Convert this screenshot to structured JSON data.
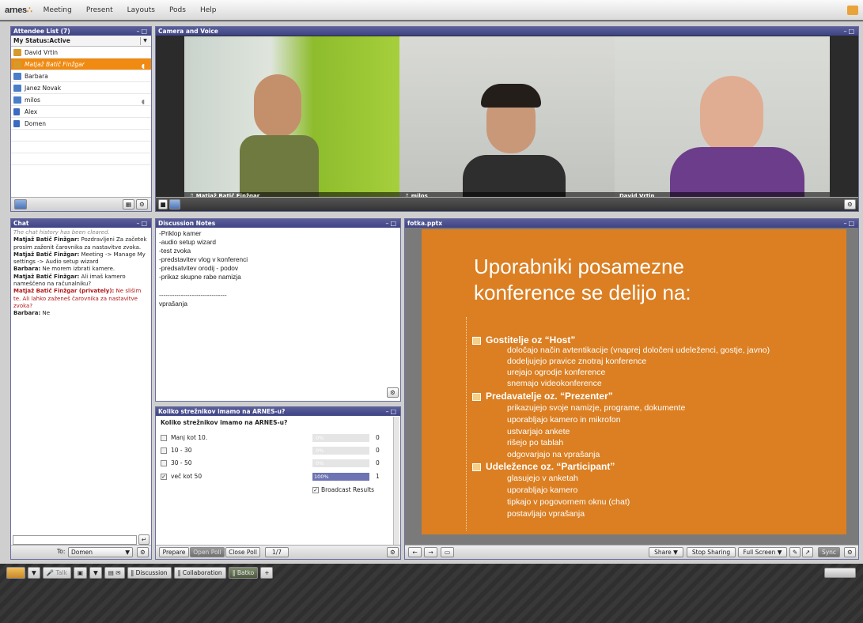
{
  "menubar": {
    "logo": "arnes",
    "items": [
      "Meeting",
      "Present",
      "Layouts",
      "Pods",
      "Help"
    ]
  },
  "attendees": {
    "title": "Attendee List (7)",
    "status": "My Status:Active",
    "rows": [
      {
        "name": "David Vrtin",
        "role": "host"
      },
      {
        "name": "Matjaž Batič Finžgar",
        "role": "host"
      },
      {
        "name": "Barbara",
        "role": "presenter"
      },
      {
        "name": "Janez Novak",
        "role": "presenter"
      },
      {
        "name": "milos",
        "role": "presenter"
      },
      {
        "name": "Alex",
        "role": "participant"
      },
      {
        "name": "Domen",
        "role": "participant"
      }
    ]
  },
  "camera": {
    "title": "Camera and Voice",
    "feeds": [
      "Matjaž Batič Finžgar",
      "milos",
      "David Vrtin"
    ]
  },
  "chat": {
    "title": "Chat",
    "history_note": "The chat history has been cleared.",
    "messages": [
      {
        "sender": "Matjaž Batič Finžgar:",
        "text": " Pozdravljeni Za začetek prosim zaženit čarovnika za nastavitve zvoka.",
        "private": false
      },
      {
        "sender": "Matjaž Batič Finžgar:",
        "text": " Meeting -> Manage My settings -> Audio setup wizard",
        "private": false
      },
      {
        "sender": "Barbara:",
        "text": " Ne morem izbrati kamere.",
        "private": false
      },
      {
        "sender": "Matjaž Batič Finžgar:",
        "text": " Ali imaš kamero nameščeno na računalniku?",
        "private": false
      },
      {
        "sender": "Matjaž Batič Finžgar (privately):",
        "text": " Ne slišim te. Ali lahko zaženeš čarovnika za nastavitve zvoka?",
        "private": true
      },
      {
        "sender": "Barbara:",
        "text": " Ne",
        "private": false
      }
    ],
    "to_label": "To:",
    "to_value": "Domen"
  },
  "notes": {
    "title": "Discussion Notes",
    "lines": [
      "-Priklop kamer",
      "-audio setup wizard",
      "-test zvoka",
      "-predstavitev vlog v konferenci",
      "-predsatvitev orodij - podov",
      "-prikaz skupne rabe namizja",
      "",
      "-------------------------------",
      "vprašanja"
    ]
  },
  "poll": {
    "title": "Koliko strežnikov imamo na ARNES-u?",
    "question": "Koliko strežnikov imamo na ARNES-u?",
    "options": [
      {
        "label": "Manj kot 10.",
        "pct": 0,
        "pct_label": "0%",
        "count": "0",
        "checked": false
      },
      {
        "label": "10 - 30",
        "pct": 0,
        "pct_label": "0%",
        "count": "0",
        "checked": false
      },
      {
        "label": "30 - 50",
        "pct": 0,
        "pct_label": "0%",
        "count": "0",
        "checked": false
      },
      {
        "label": "več kot 50",
        "pct": 100,
        "pct_label": "100%",
        "count": "1",
        "checked": true
      }
    ],
    "broadcast": "Broadcast Results",
    "buttons": [
      "Prepare",
      "Open Poll",
      "Close Poll",
      "1/7"
    ]
  },
  "slides": {
    "title": "fotka.pptx",
    "heading_line1": "Uporabniki posamezne",
    "heading_line2": "konference se delijo na:",
    "sections": [
      {
        "title": "Gostitelje oz “Host”",
        "items": [
          "določajo način avtentikacije (vnaprej določeni udeleženci, gostje, javno)",
          "dodeljujejo pravice znotraj konference",
          "urejajo ogrodje konference",
          "snemajo videokonference"
        ]
      },
      {
        "title": "Predavatelje oz. “Prezenter”",
        "items": [
          "prikazujejo svoje namizje, programe, dokumente",
          "uporabljajo kamero in mikrofon",
          "ustvarjajo ankete",
          "rišejo po tablah",
          "odgovarjajo na vprašanja"
        ]
      },
      {
        "title": "Udeležence oz. “Participant”",
        "items": [
          "glasujejo v anketah",
          "uporabljajo kamero",
          "tipkajo v pogovornem oknu (chat)",
          "postavljajo vprašanja"
        ]
      }
    ],
    "buttons": {
      "share": "Share",
      "stop": "Stop Sharing",
      "full": "Full Screen",
      "sync": "Sync"
    }
  },
  "taskbar": {
    "talk": "Talk",
    "tabs": [
      "Discussion",
      "Collaboration",
      "Batko"
    ],
    "add": "+"
  },
  "colors": {
    "accent": "#f08a10",
    "pod_title": "#474c8c",
    "slide_bg": "#db7f22"
  }
}
